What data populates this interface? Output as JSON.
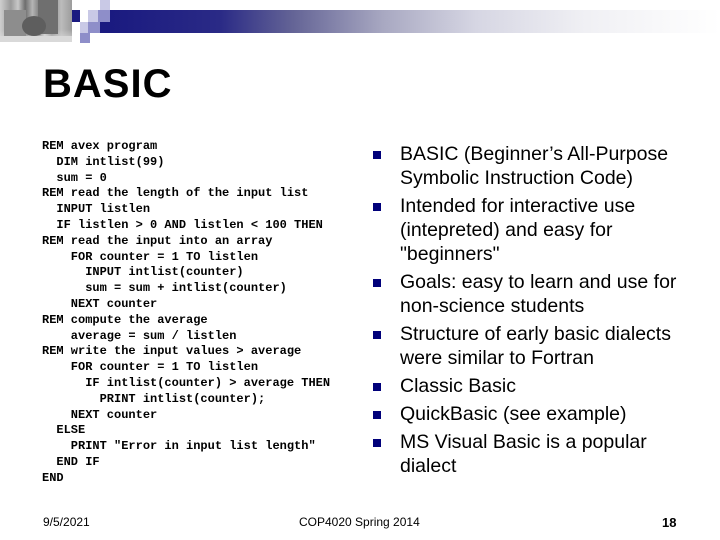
{
  "header": {
    "photo": "campus-building-photo",
    "accent_color": "#1a1a80"
  },
  "slide": {
    "title": "BASIC",
    "code_lines": [
      "REM avex program",
      "  DIM intlist(99)",
      "  sum = 0",
      "REM read the length of the input list",
      "  INPUT listlen",
      "  IF listlen > 0 AND listlen < 100 THEN",
      "REM read the input into an array",
      "    FOR counter = 1 TO listlen",
      "      INPUT intlist(counter)",
      "      sum = sum + intlist(counter)",
      "    NEXT counter",
      "REM compute the average",
      "    average = sum / listlen",
      "REM write the input values > average",
      "    FOR counter = 1 TO listlen",
      "      IF intlist(counter) > average THEN",
      "        PRINT intlist(counter);",
      "    NEXT counter",
      "  ELSE",
      "    PRINT \"Error in input list length\"",
      "  END IF",
      "END"
    ],
    "bullets": [
      "BASIC (Beginner’s All-Purpose Symbolic Instruction Code)",
      "Intended for interactive use (intepreted) and easy for \"beginners\"",
      "Goals: easy to learn and use for non-science students",
      "Structure of early basic dialects were similar to Fortran",
      "Classic Basic",
      "QuickBasic (see example)",
      "MS Visual Basic is a popular dialect"
    ],
    "bullet_icon": "square-bullet-icon",
    "bullet_color": "#00007a"
  },
  "footer": {
    "date": "9/5/2021",
    "course": "COP4020 Spring 2014",
    "page_number": "18"
  }
}
